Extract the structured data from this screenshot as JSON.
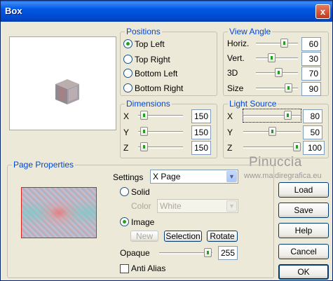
{
  "window": {
    "title": "Box",
    "close_glyph": "x"
  },
  "positions": {
    "legend": "Positions",
    "options": [
      "Top Left",
      "Top Right",
      "Bottom Left",
      "Bottom Right"
    ],
    "selected": "Top Left"
  },
  "view_angle": {
    "legend": "View Angle",
    "rows": [
      {
        "label": "Horiz.",
        "value": "60"
      },
      {
        "label": "Vert.",
        "value": "30"
      },
      {
        "label": "3D",
        "value": "70"
      },
      {
        "label": "Size",
        "value": "90"
      }
    ]
  },
  "dimensions": {
    "legend": "Dimensions",
    "rows": [
      {
        "label": "X",
        "value": "150"
      },
      {
        "label": "Y",
        "value": "150"
      },
      {
        "label": "Z",
        "value": "150"
      }
    ]
  },
  "light_source": {
    "legend": "Light Source",
    "rows": [
      {
        "label": "X",
        "value": "80"
      },
      {
        "label": "Y",
        "value": "50"
      },
      {
        "label": "Z",
        "value": "100"
      }
    ]
  },
  "page_properties": {
    "legend": "Page Properties",
    "settings_label": "Settings",
    "settings_value": "X Page",
    "solid_label": "Solid",
    "color_label": "Color",
    "color_value": "White",
    "image_label": "Image",
    "image_selected": true,
    "new_label": "New",
    "selection_label": "Selection",
    "rotate_label": "Rotate",
    "opaque_label": "Opaque",
    "opaque_value": "255",
    "anti_alias_label": "Anti Alias",
    "anti_alias_checked": false
  },
  "buttons": {
    "load": "Load",
    "save": "Save",
    "help": "Help",
    "cancel": "Cancel",
    "ok": "OK"
  },
  "watermark": {
    "line1": "Pinuccia",
    "line2": "www.maidiregrafica.eu"
  }
}
